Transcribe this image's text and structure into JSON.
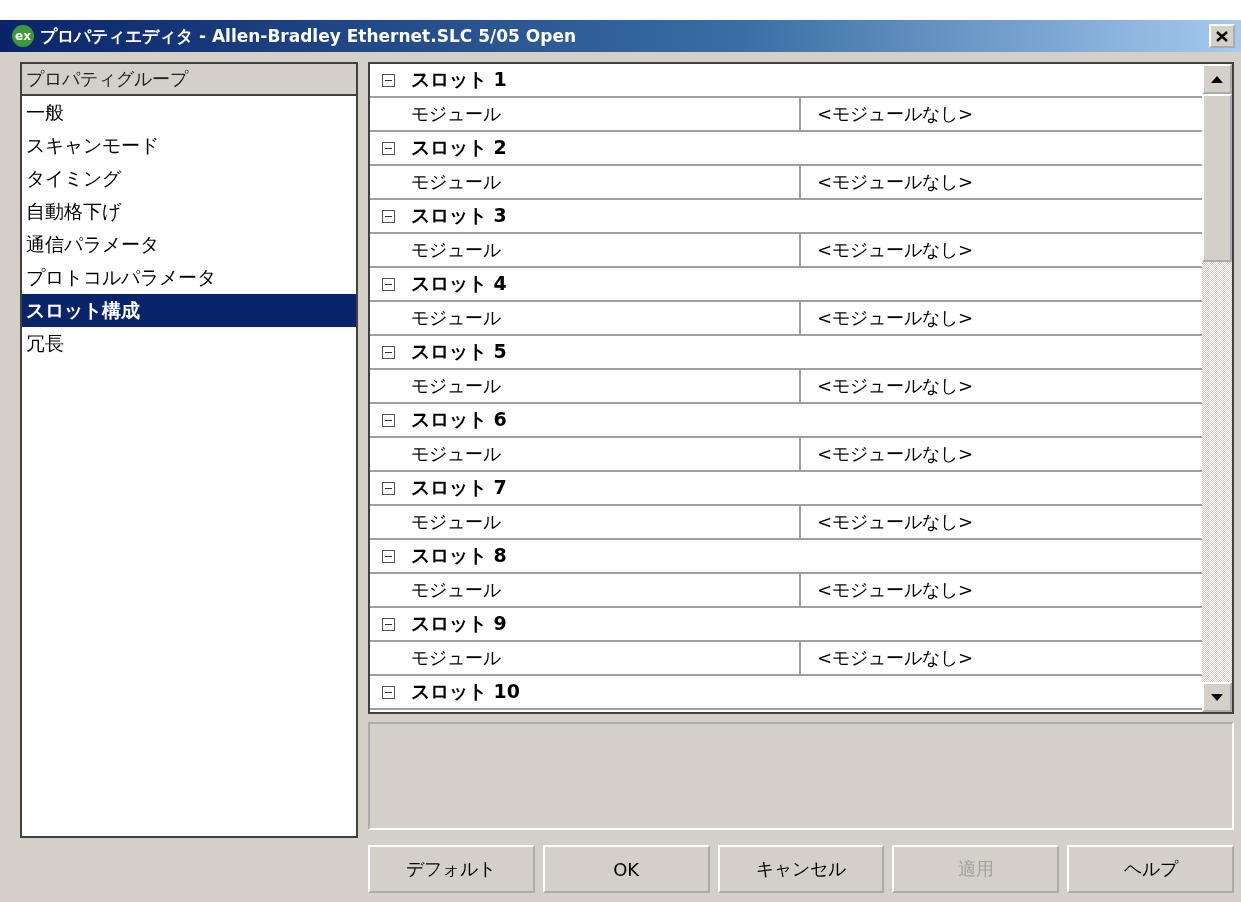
{
  "window": {
    "icon": "ex",
    "title": "プロパティエディタ - Allen-Bradley Ethernet.SLC 5/05 Open"
  },
  "groups": {
    "header": "プロパティグループ",
    "items": [
      {
        "label": "一般",
        "selected": false
      },
      {
        "label": "スキャンモード",
        "selected": false
      },
      {
        "label": "タイミング",
        "selected": false
      },
      {
        "label": "自動格下げ",
        "selected": false
      },
      {
        "label": "通信パラメータ",
        "selected": false
      },
      {
        "label": "プロトコルパラメータ",
        "selected": false
      },
      {
        "label": "スロット構成",
        "selected": true
      },
      {
        "label": "冗長",
        "selected": false
      }
    ]
  },
  "properties": [
    {
      "name": "スロット 1",
      "expanded": true,
      "rows": [
        {
          "name": "モジュール",
          "value": "<モジュールなし>"
        }
      ]
    },
    {
      "name": "スロット 2",
      "expanded": true,
      "rows": [
        {
          "name": "モジュール",
          "value": "<モジュールなし>"
        }
      ]
    },
    {
      "name": "スロット 3",
      "expanded": true,
      "rows": [
        {
          "name": "モジュール",
          "value": "<モジュールなし>"
        }
      ]
    },
    {
      "name": "スロット 4",
      "expanded": true,
      "rows": [
        {
          "name": "モジュール",
          "value": "<モジュールなし>"
        }
      ]
    },
    {
      "name": "スロット 5",
      "expanded": true,
      "rows": [
        {
          "name": "モジュール",
          "value": "<モジュールなし>"
        }
      ]
    },
    {
      "name": "スロット 6",
      "expanded": true,
      "rows": [
        {
          "name": "モジュール",
          "value": "<モジュールなし>"
        }
      ]
    },
    {
      "name": "スロット 7",
      "expanded": true,
      "rows": [
        {
          "name": "モジュール",
          "value": "<モジュールなし>"
        }
      ]
    },
    {
      "name": "スロット 8",
      "expanded": true,
      "rows": [
        {
          "name": "モジュール",
          "value": "<モジュールなし>"
        }
      ]
    },
    {
      "name": "スロット 9",
      "expanded": true,
      "rows": [
        {
          "name": "モジュール",
          "value": "<モジュールなし>"
        }
      ]
    },
    {
      "name": "スロット 10",
      "expanded": true
    }
  ],
  "buttons": [
    {
      "label": "デフォルト",
      "disabled": false
    },
    {
      "label": "OK",
      "disabled": false
    },
    {
      "label": "キャンセル",
      "disabled": false
    },
    {
      "label": "適用",
      "disabled": true
    },
    {
      "label": "ヘルプ",
      "disabled": false
    }
  ]
}
